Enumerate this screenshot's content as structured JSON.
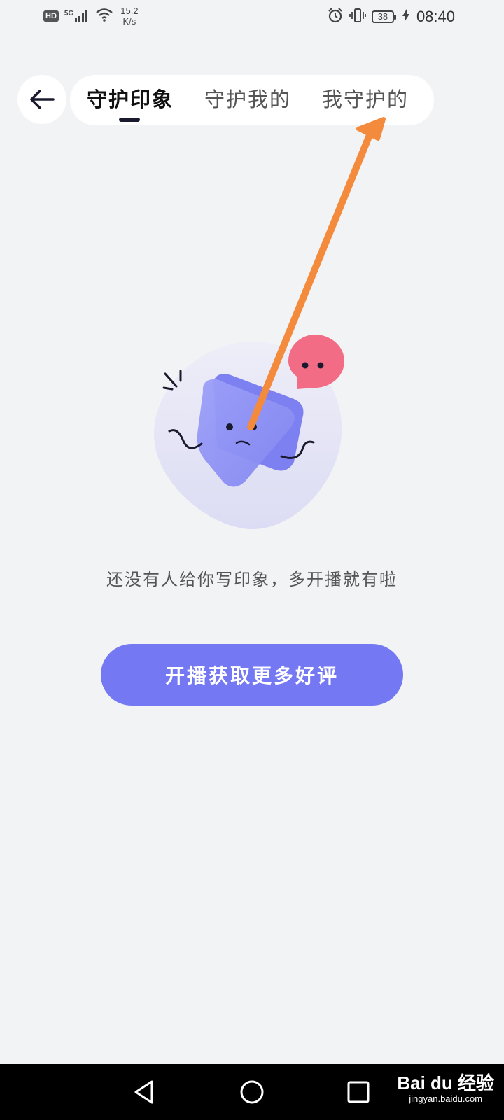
{
  "status_bar": {
    "hd": "HD",
    "network": "5G",
    "speed_value": "15.2",
    "speed_unit": "K/s",
    "battery": "38",
    "time": "08:40"
  },
  "nav": {
    "tabs": [
      {
        "label": "守护印象",
        "active": true
      },
      {
        "label": "守护我的",
        "active": false
      },
      {
        "label": "我守护的",
        "active": false
      }
    ]
  },
  "empty_state": {
    "message": "还没有人给你写印象，多开播就有啦",
    "button_label": "开播获取更多好评"
  },
  "colors": {
    "background": "#f2f3f5",
    "accent": "#7478f3",
    "annotation_arrow": "#f48a3c",
    "bubble": "#f16c84"
  },
  "watermark": {
    "brand": "Bai du 经验",
    "url": "jingyan.baidu.com"
  }
}
